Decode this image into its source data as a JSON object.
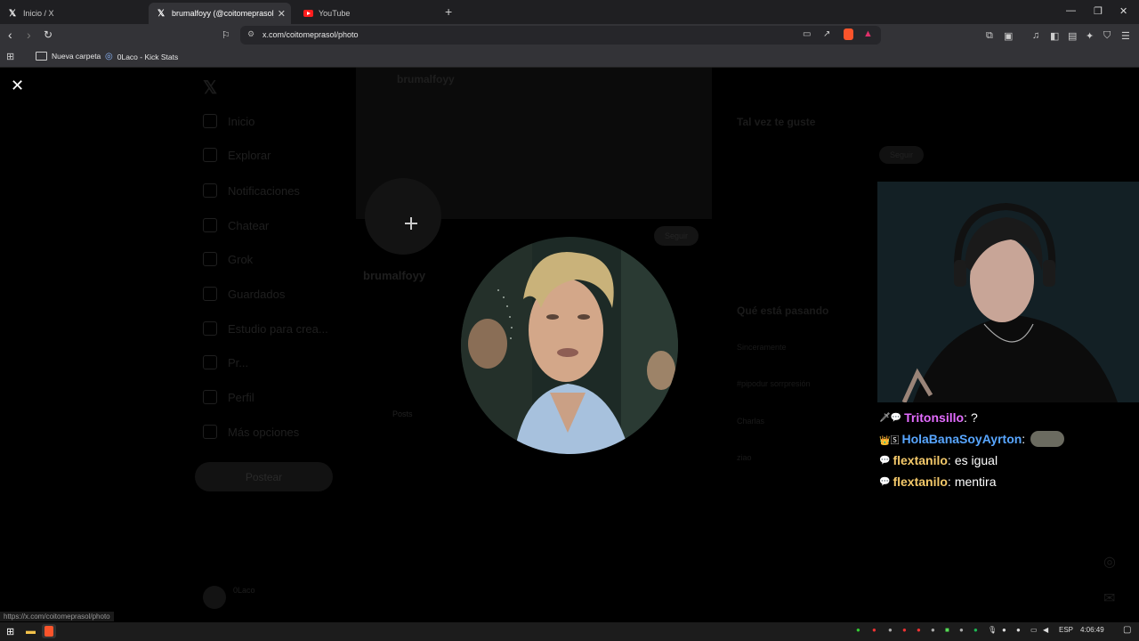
{
  "browser": {
    "tabs": [
      {
        "label": "Inicio / X",
        "icon": "x-logo-icon",
        "active": false
      },
      {
        "label": "brumalfoyy (@coitomeprasol) / X",
        "icon": "x-logo-icon",
        "active": true
      },
      {
        "label": "YouTube",
        "icon": "youtube-icon",
        "active": false
      }
    ],
    "url": "x.com/coitomeprasol/photo",
    "bookmarks": [
      {
        "label": "Nueva carpeta",
        "icon": "folder-icon"
      },
      {
        "label": "0Laco - Kick Stats",
        "icon": "kick-icon"
      }
    ],
    "status_url": "https://x.com/coitomeprasol/photo"
  },
  "background_page": {
    "header_name": "brumalfoyy",
    "profile_name": "brumalfoyy",
    "follow_label": "Seguir",
    "nav": [
      "Inicio",
      "Explorar",
      "Notificaciones",
      "Chatear",
      "Grok",
      "Guardados",
      "Estudio para crea...",
      "Pr...",
      "Perfil",
      "Más opciones"
    ],
    "post_button": "Postear",
    "who_to_follow_title": "Tal vez te guste",
    "trending_title": "Qué está pasando",
    "trends": [
      "Sinceramente",
      "#pipodur sorrpresión",
      "Charlas",
      "ziao"
    ],
    "tab_posts": "Posts",
    "account_name": "0Laco"
  },
  "chat": [
    {
      "badges": "🗡💬",
      "user": "Tritonsillo",
      "color": "#e36cff",
      "message": "?"
    },
    {
      "badges": "👑🅂",
      "user": "HolaBanaSoyAyrton",
      "color": "#58a6ff",
      "message": "",
      "emote": true
    },
    {
      "badges": "💬",
      "user": "flextanilo",
      "color": "#f4c96a",
      "message": "es igual"
    },
    {
      "badges": "💬",
      "user": "flextanilo",
      "color": "#f4c96a",
      "message": "mentira"
    }
  ],
  "taskbar": {
    "language": "ESP",
    "time": "4:06:49"
  }
}
